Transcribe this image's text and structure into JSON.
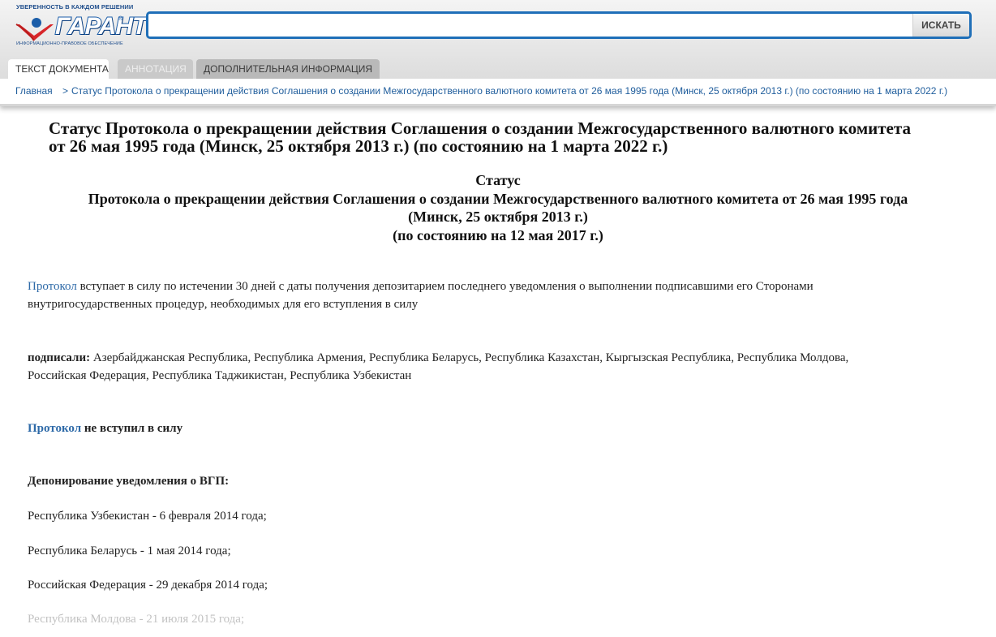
{
  "header": {
    "logo": {
      "tagline": "УВЕРЕННОСТЬ В КАЖДОМ РЕШЕНИИ",
      "wordmark": "ГАРАНТ",
      "subtitle": "ИНФОРМАЦИОННО-ПРАВОВОЕ ОБЕСПЕЧЕНИЕ"
    },
    "search": {
      "value": "",
      "placeholder": "",
      "button_label": "ИСКАТЬ"
    }
  },
  "tabs": [
    {
      "label": "ТЕКСТ ДОКУМЕНТА",
      "state": "active"
    },
    {
      "label": "АННОТАЦИЯ",
      "state": "disabled"
    },
    {
      "label": "ДОПОЛНИТЕЛЬНАЯ ИНФОРМАЦИЯ",
      "state": "normal"
    }
  ],
  "breadcrumb": {
    "home": "Главная",
    "separator": ">",
    "current": "Статус Протокола о прекращении действия Соглашения о создании Межгосударственного валютного комитета от 26 мая 1995 года (Минск, 25 октября 2013 г.) (по состоянию на 1 марта 2022 г.)"
  },
  "document": {
    "title_lines": [
      "Статус Протокола о прекращении действия Соглашения о создании Межгосударственного валютного комитета",
      "от 26 мая 1995 года (Минск, 25 октября 2013 г.) (по состоянию на 1 марта 2022 г.)"
    ],
    "heading_lines": [
      "Статус",
      "Протокола о прекращении действия Соглашения о создании Межгосударственного валютного комитета от 26 мая 1995 года",
      "(Минск, 25 октября 2013 г.)",
      "(по состоянию на 12 мая 2017 г.)"
    ],
    "entry_into_force": {
      "link": "Протокол",
      "line1": " вступает в силу по истечении 30 дней с даты получения депозитарием последнего уведомления о выполнении подписавшими его Сторонами",
      "line2": "внутригосударственных процедур, необходимых для его вступления в силу"
    },
    "signed": {
      "label": "подписали:",
      "line1": " Азербайджанская Республика, Республика Армения, Республика Беларусь, Республика Казахстан, Кыргызская Республика, Республика Молдова,",
      "line2": "Российская Федерация, Республика Таджикистан, Республика Узбекистан"
    },
    "status": {
      "link": "Протокол",
      "text": " не вступил в силу"
    },
    "deposit_heading": "Депонирование уведомления о ВГП:",
    "deposits": [
      "Республика Узбекистан - 6 февраля 2014 года;",
      "Республика Беларусь - 1 мая 2014 года;",
      "Российская Федерация - 29 декабря 2014 года;",
      "Республика Молдова - 21 июля 2015 года;"
    ]
  }
}
